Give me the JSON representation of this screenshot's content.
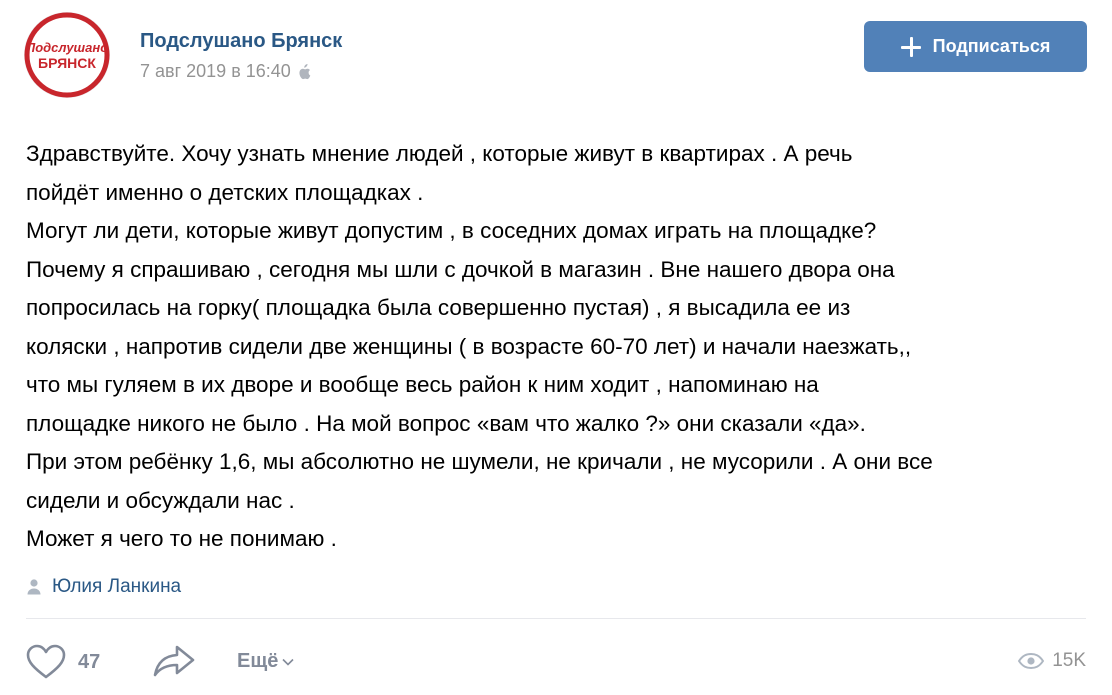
{
  "header": {
    "group_name": "Подслушано Брянск",
    "date": "7 авг 2019 в 16:40",
    "platform_icon": "apple-icon",
    "avatar_logo": {
      "line1": "Подслушано",
      "line2": "БРЯНСК"
    },
    "subscribe_label": "Подписаться"
  },
  "post": {
    "lines": [
      "Здравствуйте. Хочу узнать мнение людей , которые живут в квартирах . А речь",
      "пойдёт именно о детских площадках .",
      "Могут ли дети, которые живут допустим , в соседних домах играть на площадке?",
      "Почему я спрашиваю , сегодня мы шли с дочкой в магазин . Вне нашего двора она",
      "попросилась на горку( площадка была совершенно пустая) , я высадила ее из",
      "коляски , напротив сидели две женщины ( в возрасте 60-70 лет) и начали наезжать,,",
      "что мы гуляем в их дворе и вообще весь район к ним ходит , напоминаю на",
      "площадке никого не было . На мой вопрос «вам что жалко ?» они сказали «да».",
      "При этом ребёнку 1,6, мы абсолютно не шумели, не кричали , не мусорили . А они все",
      "сидели и обсуждали нас .",
      "Может я чего то не понимаю ."
    ]
  },
  "author": {
    "name": "Юлия Ланкина",
    "icon": "user-icon"
  },
  "actions": {
    "likes": "47",
    "more_label": "Ещё",
    "views": "15K"
  },
  "colors": {
    "accent": "#5181b8",
    "link": "#2a5885",
    "muted": "#828a99",
    "logo_red": "#c8262c"
  }
}
